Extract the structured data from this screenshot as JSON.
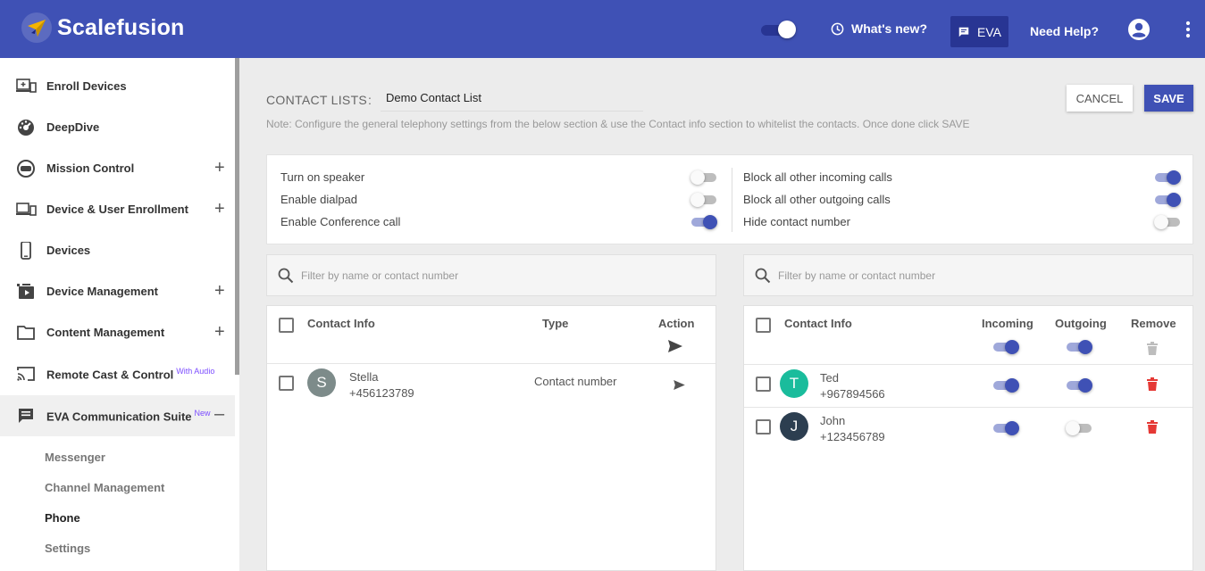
{
  "header": {
    "brand": "Scalefusion",
    "whats_new": "What's new?",
    "eva": "EVA",
    "need_help": "Need Help?",
    "toggle_on": true
  },
  "sidebar": {
    "items": [
      {
        "label": "Enroll Devices",
        "icon": "enroll-devices-icon",
        "expandable": false
      },
      {
        "label": "DeepDive",
        "icon": "dashboard-gauge-icon",
        "expandable": false
      },
      {
        "label": "Mission Control",
        "icon": "mission-control-icon",
        "expandable": true
      },
      {
        "label": "Device & User Enrollment",
        "icon": "device-enrollment-icon",
        "expandable": true
      },
      {
        "label": "Devices",
        "icon": "phone-icon",
        "expandable": false
      },
      {
        "label": "Device Management",
        "icon": "device-management-icon",
        "expandable": true
      },
      {
        "label": "Content Management",
        "icon": "folder-icon",
        "expandable": true
      },
      {
        "label": "Remote Cast & Control",
        "badge": "With Audio",
        "icon": "cast-icon",
        "expandable": false
      },
      {
        "label": "EVA Communication Suite",
        "badge": "New",
        "icon": "chat-icon",
        "expandable": true,
        "expanded": true
      }
    ],
    "subitems": [
      "Messenger",
      "Channel Management",
      "Phone",
      "Settings"
    ],
    "current_subitem": "Phone"
  },
  "main": {
    "contact_lists_label": "CONTACT LISTS",
    "colon": ":",
    "contact_list_name": "Demo Contact List",
    "cancel": "CANCEL",
    "save": "SAVE",
    "note": "Note: Configure the general telephony settings from the below section & use the Contact info section to whitelist the contacts. Once done click SAVE",
    "settings_left": [
      {
        "label": "Turn on speaker",
        "on": false
      },
      {
        "label": "Enable dialpad",
        "on": false
      },
      {
        "label": "Enable Conference call",
        "on": true
      }
    ],
    "settings_right": [
      {
        "label": "Block all other incoming calls",
        "on": true
      },
      {
        "label": "Block all other outgoing calls",
        "on": true
      },
      {
        "label": "Hide contact number",
        "on": false
      }
    ],
    "left_search_placeholder": "Filter by name or contact number",
    "right_search_placeholder": "Filter by name or contact number",
    "left_table": {
      "headers": {
        "contact": "Contact Info",
        "type": "Type",
        "action": "Action"
      },
      "rows": [
        {
          "initial": "S",
          "name": "Stella",
          "number": "+456123789",
          "type": "Contact number",
          "avatar_color": "#7d8b8a"
        }
      ]
    },
    "right_table": {
      "headers": {
        "contact": "Contact Info",
        "incoming": "Incoming",
        "outgoing": "Outgoing",
        "remove": "Remove"
      },
      "header_incoming_on": true,
      "header_outgoing_on": true,
      "rows": [
        {
          "initial": "T",
          "name": "Ted",
          "number": "+967894566",
          "incoming": true,
          "outgoing": true,
          "avatar_color": "#1abc9c"
        },
        {
          "initial": "J",
          "name": "John",
          "number": "+123456789",
          "incoming": true,
          "outgoing": false,
          "avatar_color": "#2c3e50"
        }
      ]
    }
  },
  "colors": {
    "primary": "#3f51b5",
    "primary_dark": "#283593",
    "delete": "#e53935"
  }
}
